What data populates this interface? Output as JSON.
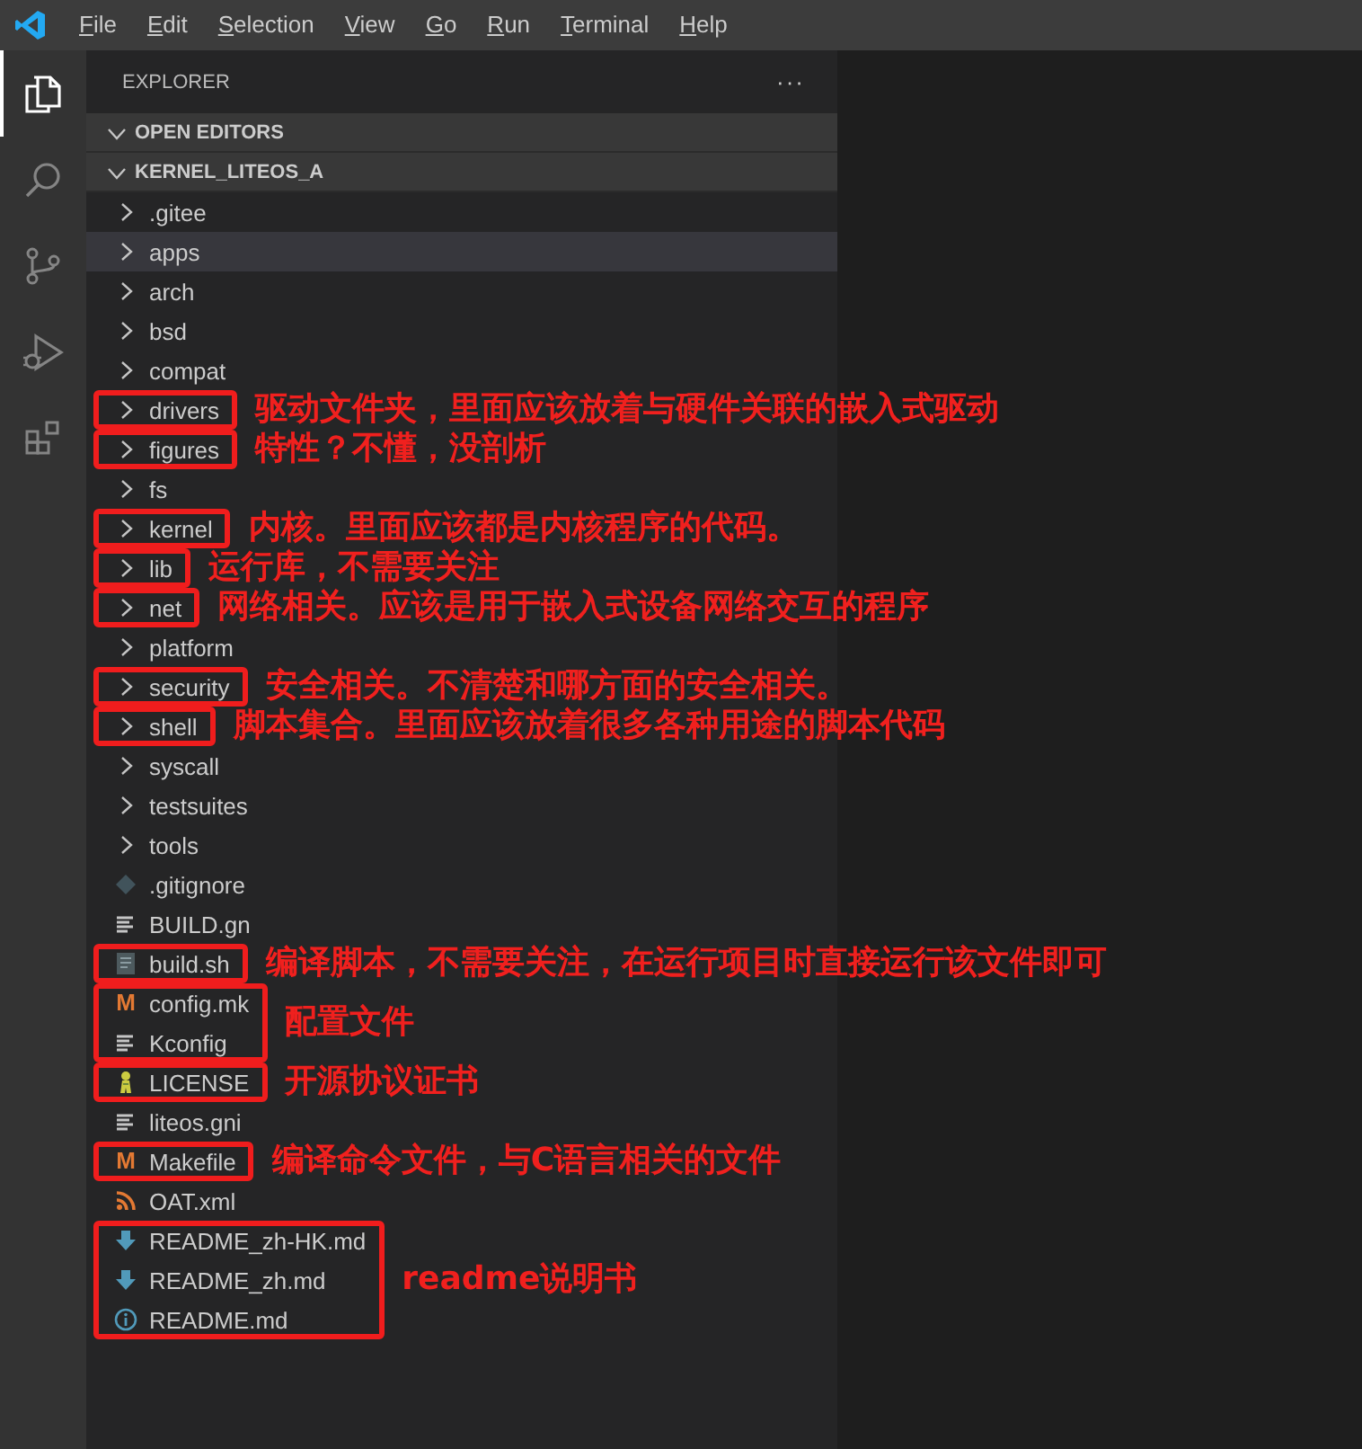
{
  "menu": [
    {
      "label": "File"
    },
    {
      "label": "Edit"
    },
    {
      "label": "Selection"
    },
    {
      "label": "View"
    },
    {
      "label": "Go"
    },
    {
      "label": "Run"
    },
    {
      "label": "Terminal"
    },
    {
      "label": "Help"
    }
  ],
  "activity": [
    {
      "kind": "explorer",
      "selected": true
    },
    {
      "kind": "search",
      "selected": false
    },
    {
      "kind": "scm",
      "selected": false
    },
    {
      "kind": "debug",
      "selected": false
    },
    {
      "kind": "extensions",
      "selected": false
    }
  ],
  "explorer": {
    "title": "EXPLORER",
    "more": "···",
    "sections": [
      {
        "label": "OPEN EDITORS",
        "expanded": true
      },
      {
        "label": "KERNEL_LITEOS_A",
        "expanded": true
      }
    ],
    "tree": [
      {
        "name": ".gitee",
        "kind": "folder",
        "selected": false
      },
      {
        "name": "apps",
        "kind": "folder",
        "selected": true
      },
      {
        "name": "arch",
        "kind": "folder",
        "selected": false
      },
      {
        "name": "bsd",
        "kind": "folder",
        "selected": false
      },
      {
        "name": "compat",
        "kind": "folder",
        "selected": false
      },
      {
        "kind": "annotated",
        "note": "驱动文件夹，里面应该放着与硬件关联的嵌入式驱动",
        "items": [
          {
            "name": "drivers",
            "kind": "folder",
            "selected": false
          }
        ]
      },
      {
        "kind": "annotated",
        "note": "特性？不懂，没剖析",
        "items": [
          {
            "name": "figures",
            "kind": "folder",
            "selected": false
          }
        ]
      },
      {
        "name": "fs",
        "kind": "folder",
        "selected": false
      },
      {
        "kind": "annotated",
        "note": "内核。里面应该都是内核程序的代码。",
        "items": [
          {
            "name": "kernel",
            "kind": "folder",
            "selected": false
          }
        ]
      },
      {
        "kind": "annotated",
        "note": "运行库，不需要关注",
        "items": [
          {
            "name": "lib",
            "kind": "folder",
            "selected": false
          }
        ]
      },
      {
        "kind": "annotated",
        "note": "网络相关。应该是用于嵌入式设备网络交互的程序",
        "items": [
          {
            "name": "net",
            "kind": "folder",
            "selected": false
          }
        ]
      },
      {
        "name": "platform",
        "kind": "folder",
        "selected": false
      },
      {
        "kind": "annotated",
        "note": "安全相关。不清楚和哪方面的安全相关。",
        "items": [
          {
            "name": "security",
            "kind": "folder",
            "selected": false
          }
        ]
      },
      {
        "kind": "annotated",
        "note": "脚本集合。里面应该放着很多各种用途的脚本代码",
        "items": [
          {
            "name": "shell",
            "kind": "folder",
            "selected": false
          }
        ]
      },
      {
        "name": "syscall",
        "kind": "folder",
        "selected": false
      },
      {
        "name": "testsuites",
        "kind": "folder",
        "selected": false
      },
      {
        "name": "tools",
        "kind": "folder",
        "selected": false
      },
      {
        "name": ".gitignore",
        "kind": "git",
        "selected": false
      },
      {
        "name": "BUILD.gn",
        "kind": "lines",
        "selected": false
      },
      {
        "kind": "annotated",
        "note": "编译脚本，不需要关注，在运行项目时直接运行该文件即可",
        "items": [
          {
            "name": "build.sh",
            "kind": "script",
            "selected": false
          }
        ]
      },
      {
        "kind": "annotated",
        "note": "配置文件",
        "items": [
          {
            "name": "config.mk",
            "kind": "make",
            "glyph": "M",
            "selected": false
          },
          {
            "name": "Kconfig",
            "kind": "lines",
            "selected": false
          }
        ]
      },
      {
        "kind": "annotated",
        "note": "开源协议证书",
        "items": [
          {
            "name": "LICENSE",
            "kind": "license",
            "selected": false
          }
        ]
      },
      {
        "name": "liteos.gni",
        "kind": "lines",
        "selected": false
      },
      {
        "kind": "annotated",
        "note": "编译命令文件，与C语言相关的文件",
        "items": [
          {
            "name": "Makefile",
            "kind": "make",
            "glyph": "M",
            "selected": false
          }
        ]
      },
      {
        "name": "OAT.xml",
        "kind": "rss",
        "selected": false
      },
      {
        "kind": "annotated",
        "note": "readme说明书",
        "items": [
          {
            "name": "README_zh-HK.md",
            "kind": "download",
            "selected": false
          },
          {
            "name": "README_zh.md",
            "kind": "download",
            "selected": false
          },
          {
            "name": "README.md",
            "kind": "info",
            "selected": false
          }
        ]
      }
    ]
  }
}
